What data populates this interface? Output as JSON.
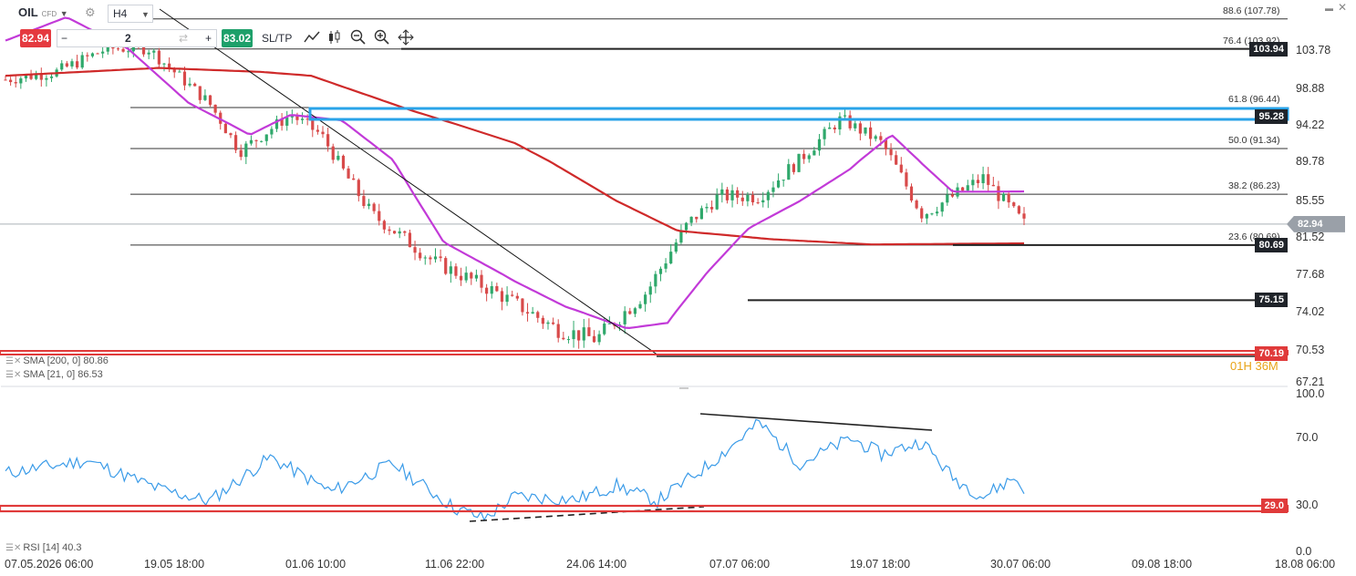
{
  "toolbar": {
    "symbol": "OIL",
    "symbol_type": "CFD",
    "timeframe": "H4",
    "sell_price": "82.94",
    "volume": "2",
    "buy_price": "83.02",
    "sl_tp": "SL/TP",
    "minus": "−",
    "plus": "+",
    "icons": [
      "line-chart-icon",
      "candles-icon",
      "zoom-out-icon",
      "zoom-in-icon",
      "move-icon",
      "refresh-icon"
    ]
  },
  "window_controls": {
    "minimize": "▬",
    "close": "✕"
  },
  "indicators": {
    "sma200": "SMA [200, 0] 80.86",
    "sma21": "SMA [21, 0] 86.53",
    "rsi": "RSI [14] 40.3"
  },
  "countdown": "01H 36M",
  "price_tags": [
    {
      "value": "103.94",
      "color": "#1f2329"
    },
    {
      "value": "95.28",
      "color": "#1f2329"
    },
    {
      "value": "82.94",
      "color": "#9aa0a8"
    },
    {
      "value": "80.69",
      "color": "#1f2329"
    },
    {
      "value": "75.15",
      "color": "#1f2329"
    },
    {
      "value": "70.19",
      "color": "#e03a3a"
    },
    {
      "value": "29.0",
      "color": "#e03a3a"
    }
  ],
  "fib_labels": [
    "88.6 (107.78)",
    "76.4 (103.92)",
    "61.8 (96.44)",
    "50.0 (91.34)",
    "38.2 (86.23)",
    "23.6 (80.69)"
  ],
  "chart_data": {
    "type": "candlestick",
    "instrument": "OIL CFD",
    "timeframe": "H4",
    "y_ticks": [
      "103.78",
      "98.88",
      "94.22",
      "89.78",
      "85.55",
      "81.52",
      "77.68",
      "74.02",
      "70.53",
      "67.21"
    ],
    "y_range": [
      67.21,
      107.78
    ],
    "rsi_ticks": [
      "100.0",
      "70.0",
      "30.0",
      "0.0"
    ],
    "x_ticks": [
      "07.05.2026 06:00",
      "19.05 18:00",
      "01.06 10:00",
      "11.06 22:00",
      "24.06 14:00",
      "07.07 06:00",
      "19.07 18:00",
      "30.07 06:00",
      "09.08 18:00",
      "18.08 06:00"
    ],
    "last_price": 82.94,
    "path_anchors": [
      [
        0,
        100
      ],
      [
        0.05,
        101
      ],
      [
        0.1,
        104
      ],
      [
        0.14,
        104
      ],
      [
        0.2,
        97
      ],
      [
        0.23,
        91
      ],
      [
        0.28,
        95.5
      ],
      [
        0.31,
        93
      ],
      [
        0.33,
        89
      ],
      [
        0.36,
        84
      ],
      [
        0.42,
        79
      ],
      [
        0.48,
        76
      ],
      [
        0.54,
        72.5
      ],
      [
        0.58,
        71.5
      ],
      [
        0.63,
        76
      ],
      [
        0.67,
        83
      ],
      [
        0.7,
        86
      ],
      [
        0.74,
        86
      ],
      [
        0.78,
        90
      ],
      [
        0.82,
        95
      ],
      [
        0.86,
        92
      ],
      [
        0.9,
        84
      ],
      [
        0.93,
        86
      ],
      [
        0.96,
        88
      ],
      [
        1,
        83
      ]
    ],
    "sma200_anchors": [
      [
        0,
        100.5
      ],
      [
        0.15,
        101.5
      ],
      [
        0.25,
        101.0
      ],
      [
        0.3,
        100.5
      ],
      [
        0.4,
        96.0
      ],
      [
        0.5,
        92.0
      ],
      [
        0.6,
        85.5
      ],
      [
        0.66,
        82.2
      ],
      [
        0.75,
        81.3
      ],
      [
        0.85,
        80.75
      ],
      [
        1,
        80.86
      ]
    ],
    "sma21_anchors": [
      [
        0,
        105
      ],
      [
        0.06,
        108
      ],
      [
        0.12,
        104
      ],
      [
        0.18,
        97
      ],
      [
        0.24,
        93
      ],
      [
        0.28,
        95.5
      ],
      [
        0.33,
        94.8
      ],
      [
        0.38,
        90
      ],
      [
        0.43,
        81
      ],
      [
        0.5,
        77
      ],
      [
        0.55,
        74.5
      ],
      [
        0.61,
        72.5
      ],
      [
        0.65,
        73
      ],
      [
        0.69,
        78
      ],
      [
        0.73,
        82.5
      ],
      [
        0.78,
        85.5
      ],
      [
        0.83,
        89
      ],
      [
        0.87,
        93
      ],
      [
        0.9,
        89.5
      ],
      [
        0.93,
        86.5
      ],
      [
        0.96,
        86.5
      ],
      [
        1,
        86.53
      ]
    ],
    "rsi_anchors": [
      [
        0,
        50
      ],
      [
        0.08,
        58
      ],
      [
        0.15,
        40
      ],
      [
        0.2,
        32
      ],
      [
        0.26,
        60
      ],
      [
        0.32,
        38
      ],
      [
        0.38,
        56
      ],
      [
        0.44,
        28
      ],
      [
        0.47,
        21
      ],
      [
        0.5,
        35
      ],
      [
        0.56,
        33
      ],
      [
        0.6,
        42
      ],
      [
        0.64,
        32
      ],
      [
        0.69,
        55
      ],
      [
        0.74,
        82
      ],
      [
        0.78,
        56
      ],
      [
        0.83,
        72
      ],
      [
        0.86,
        62
      ],
      [
        0.9,
        70
      ],
      [
        0.93,
        47
      ],
      [
        0.96,
        35
      ],
      [
        0.99,
        47
      ],
      [
        1,
        40.3
      ]
    ],
    "horizontal_levels": [
      103.94,
      95.28,
      80.69,
      75.15,
      70.19
    ],
    "rsi_level": 29.0
  }
}
